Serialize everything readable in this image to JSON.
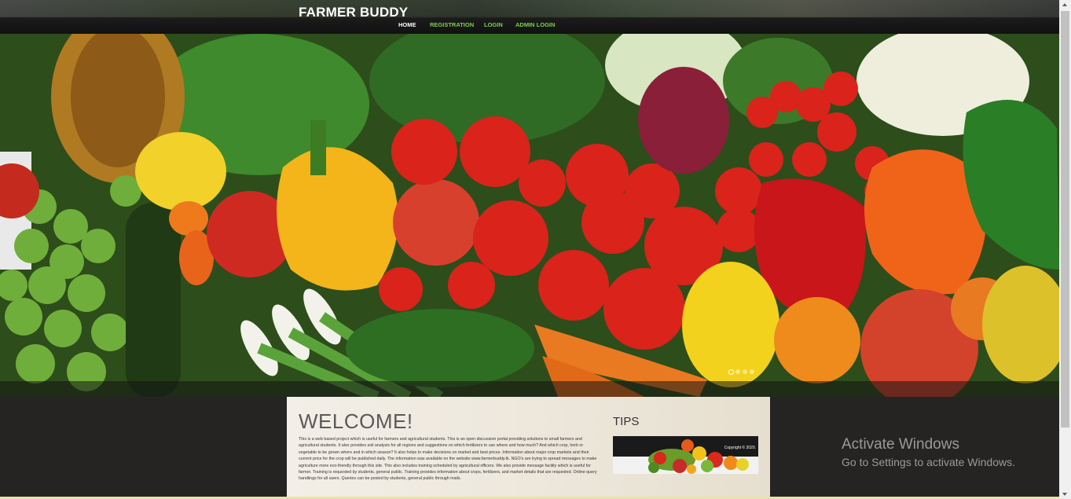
{
  "header": {
    "brand": "FARMER BUDDY",
    "nav": [
      {
        "label": "HOME",
        "active": true
      },
      {
        "label": "REGISTRATION",
        "active": false
      },
      {
        "label": "LOGIN",
        "active": false
      },
      {
        "label": "ADMIN LOGIN",
        "active": false
      }
    ]
  },
  "hero": {
    "image": "fresh-vegetables-and-fruits-photo",
    "slide_count": 4,
    "active_slide": 1
  },
  "welcome": {
    "title": "WELCOME!",
    "text": "This is a web based project which is useful for farmers and agricultural students. This is an open discussion portal providing solutions to small farmers and agricultural students. It also provides soil analysis for all regions and suggestions on which fertilizers to use where and how much? And which crop, herb or vegetable to be grown where and in which season? It also helps to make decisions on market and best prices. Information about major crop markets and their current price for the crop will be published daily. The information was available on the website www.farmerbuddy.tk. NGO's are trying to spread messages to make agriculture more eco-friendly through this site. This also includes training scheduled by agricultural officers. We also provide message facility which is useful for farmer. Training is requested by students, general public. Training provides information about crops, fertilizers, and market details that are requested. Online query handlings for all users. Queries can be posted by students, general public through mails."
  },
  "tips": {
    "title": "TIPS",
    "image": "fruit-and-vegetable-banner",
    "caption": "Copyright © 2020."
  },
  "windows_watermark": {
    "line1": "Activate Windows",
    "line2": "Go to Settings to activate Windows."
  },
  "colors": {
    "nav_link": "#7bd04a",
    "nav_active": "#ffffff",
    "page_bg": "#252423",
    "content_bg": "#efeae0"
  }
}
